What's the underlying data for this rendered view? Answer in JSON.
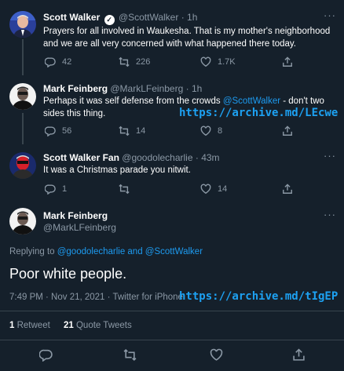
{
  "tweets": [
    {
      "name": "Scott Walker",
      "handle": "@ScottWalker",
      "time": "· 1h",
      "text": "Prayers for all involved in Waukesha. That is my mother's neighborhood and we are all very concerned with what happened there today.",
      "replies": "42",
      "retweets": "226",
      "likes": "1.7K"
    },
    {
      "name": "Mark Feinberg",
      "handle": "@MarkLFeinberg",
      "time": "· 1h",
      "text_before": "Perhaps it was self defense from the crowds ",
      "mention": "@ScottWalker",
      "text_after": " - don't two sides this thing.",
      "replies": "56",
      "retweets": "14",
      "likes": "8",
      "archive_link": "https://archive.md/LEcwe"
    },
    {
      "name": "Scott Walker Fan",
      "handle": "@goodolecharlie",
      "time": "· 43m",
      "text": "It was a Christmas parade you nitwit.",
      "replies": "1",
      "retweets": "",
      "likes": "14"
    }
  ],
  "main_tweet": {
    "name": "Mark Feinberg",
    "handle": "@MarkLFeinberg",
    "replying_prefix": "Replying to ",
    "replying_to": "@goodolecharlie and @ScottWalker",
    "text": "Poor white people.",
    "meta": "7:49 PM · Nov 21, 2021 · Twitter for iPhone",
    "archive_link": "https://archive.md/tIgEP",
    "retweet_count": "1",
    "retweet_label": " Retweet",
    "quote_count": "21",
    "quote_label": " Quote Tweets"
  },
  "colors": {
    "background": "#15202b",
    "accent": "#1d9bf0",
    "muted": "#8b98a5",
    "archive_link": "#1da1f2"
  },
  "icons": [
    "verified-badge-icon",
    "more-icon",
    "reply-icon",
    "retweet-icon",
    "like-icon",
    "share-icon"
  ]
}
